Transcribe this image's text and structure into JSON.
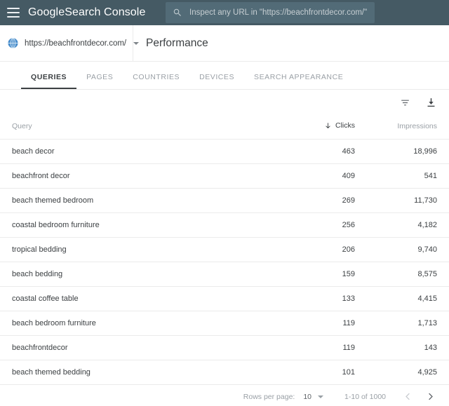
{
  "topbar": {
    "menu_icon": "hamburger-icon",
    "brand_part1": "Google",
    "brand_part2": "Search Console",
    "search_icon": "search-icon",
    "search_placeholder": "Inspect any URL in \"https://beachfrontdecor.com/\"",
    "bg_color": "#455a64"
  },
  "subbar": {
    "property_icon": "globe-info-icon",
    "property_name": "https://beachfrontdecor.com/",
    "property_caret_icon": "chevron-down-icon",
    "page_title": "Performance"
  },
  "tabs": [
    {
      "label": "QUERIES",
      "active": true
    },
    {
      "label": "PAGES",
      "active": false
    },
    {
      "label": "COUNTRIES",
      "active": false
    },
    {
      "label": "DEVICES",
      "active": false
    },
    {
      "label": "SEARCH APPEARANCE",
      "active": false
    }
  ],
  "toolbar": {
    "filter_icon": "filter-icon",
    "download_icon": "download-icon"
  },
  "table": {
    "columns": {
      "query": "Query",
      "clicks": "Clicks",
      "impressions": "Impressions"
    },
    "sort": {
      "column": "Clicks",
      "direction": "desc",
      "icon": "arrow-down-icon"
    },
    "colors": {
      "clicks": "#4285c5",
      "impressions": "#18b8c9"
    },
    "rows": [
      {
        "query": "beach decor",
        "clicks": "463",
        "impressions": "18,996"
      },
      {
        "query": "beachfront decor",
        "clicks": "409",
        "impressions": "541"
      },
      {
        "query": "beach themed bedroom",
        "clicks": "269",
        "impressions": "11,730"
      },
      {
        "query": "coastal bedroom furniture",
        "clicks": "256",
        "impressions": "4,182"
      },
      {
        "query": "tropical bedding",
        "clicks": "206",
        "impressions": "9,740"
      },
      {
        "query": "beach bedding",
        "clicks": "159",
        "impressions": "8,575"
      },
      {
        "query": "coastal coffee table",
        "clicks": "133",
        "impressions": "4,415"
      },
      {
        "query": "beach bedroom furniture",
        "clicks": "119",
        "impressions": "1,713"
      },
      {
        "query": "beachfrontdecor",
        "clicks": "119",
        "impressions": "143"
      },
      {
        "query": "beach themed bedding",
        "clicks": "101",
        "impressions": "4,925"
      }
    ]
  },
  "footer": {
    "rows_per_page_label": "Rows per page:",
    "rows_per_page_value": "10",
    "rows_per_page_caret": "chevron-down-icon",
    "range_text": "1-10 of 1000",
    "prev_icon": "chevron-left-icon",
    "next_icon": "chevron-right-icon"
  }
}
